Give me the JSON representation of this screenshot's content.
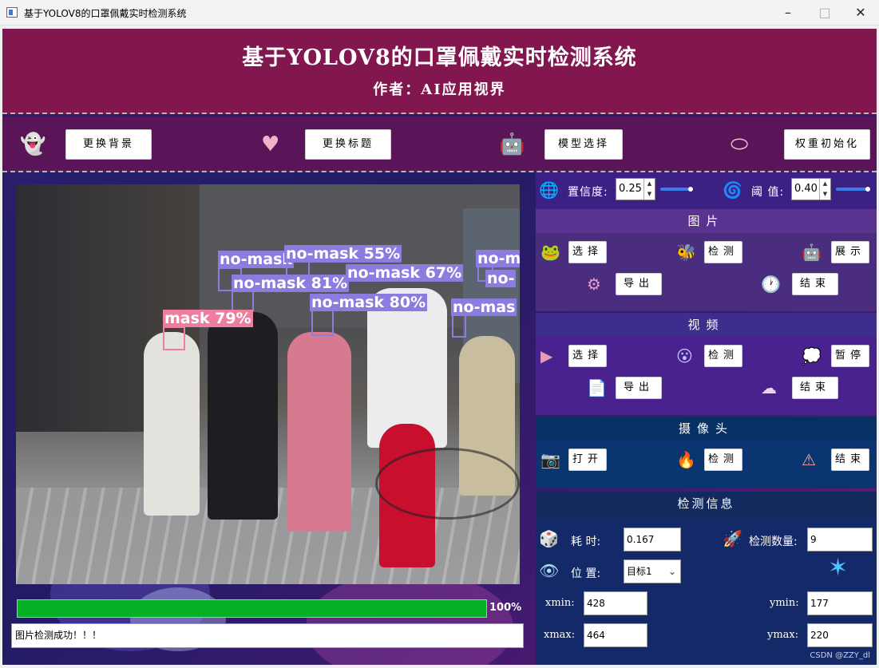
{
  "window": {
    "title": "基于YOLOV8的口罩佩戴实时检测系统"
  },
  "header": {
    "title": "基于YOLOV8的口罩佩戴实时检测系统",
    "subtitle": "作者：AI应用视界"
  },
  "toolbar": {
    "change_bg": "更换背景",
    "change_title": "更换标题",
    "model_select": "模型选择",
    "weight_init": "权重初始化"
  },
  "detections": [
    {
      "label": "no-mask 55%",
      "class": "no-mask"
    },
    {
      "label": "no-mask",
      "class": "no-mask"
    },
    {
      "label": "no-mask 81%",
      "class": "no-mask"
    },
    {
      "label": "no-mask 67%",
      "class": "no-mask"
    },
    {
      "label": "no-mask 80%",
      "class": "no-mask"
    },
    {
      "label": "mask 79%",
      "class": "mask"
    },
    {
      "label": "no-m",
      "class": "no-mask"
    },
    {
      "label": "no-",
      "class": "no-mask"
    },
    {
      "label": "no-mas",
      "class": "no-mask"
    }
  ],
  "progress": {
    "value": 1.0,
    "text": "100%"
  },
  "status_text": "图片检测成功！！！",
  "params": {
    "conf_label": "置信度:",
    "conf_value": "0.25",
    "conf_level": 0.25,
    "iou_label": "阈 值:",
    "iou_value": "0.40",
    "iou_level": 0.4
  },
  "image_section": {
    "title": "图片",
    "select": "选择",
    "detect": "检测",
    "show": "展示",
    "export": "导出",
    "stop": "结束"
  },
  "video_section": {
    "title": "视频",
    "select": "选择",
    "detect": "检测",
    "pause": "暂停",
    "export": "导出",
    "stop": "结束"
  },
  "camera_section": {
    "title": "摄像头",
    "open": "打开",
    "detect": "检测",
    "stop": "结束"
  },
  "info_section": {
    "title": "检测信息",
    "time_label": "耗  时:",
    "time_value": "0.167",
    "count_label": "检测数量:",
    "count_value": "9",
    "pos_label": "位  置:",
    "pos_value": "目标1",
    "xmin_label": "xmin:",
    "xmin_value": "428",
    "ymin_label": "ymin:",
    "ymin_value": "177",
    "xmax_label": "xmax:",
    "xmax_value": "464",
    "ymax_label": "ymax:",
    "ymax_value": "220"
  },
  "watermark": "CSDN @ZZY_dl",
  "colors": {
    "header": "#82164f",
    "toolbar": "#5a1559",
    "no_mask_box": "#8c7ce0",
    "mask_box": "#ef7da0",
    "progress": "#06b025",
    "slider": "#3d7be8"
  }
}
